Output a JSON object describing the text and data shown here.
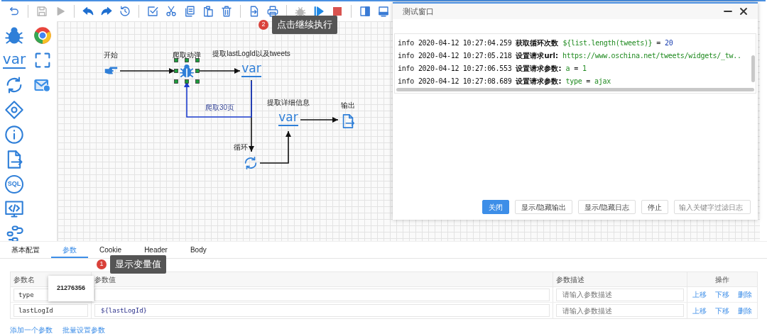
{
  "toolbar": [
    {
      "kind": "reset",
      "disabled": false
    },
    {
      "kind": "separator"
    },
    {
      "kind": "save",
      "disabled": true
    },
    {
      "kind": "play",
      "disabled": true
    },
    {
      "kind": "separator"
    },
    {
      "kind": "undo",
      "disabled": false
    },
    {
      "kind": "redo",
      "disabled": false
    },
    {
      "kind": "history",
      "disabled": false
    },
    {
      "kind": "separator"
    },
    {
      "kind": "select",
      "disabled": false
    },
    {
      "kind": "cut",
      "disabled": false
    },
    {
      "kind": "copy",
      "disabled": false
    },
    {
      "kind": "paste",
      "disabled": false
    },
    {
      "kind": "delete",
      "disabled": false
    },
    {
      "kind": "separator"
    },
    {
      "kind": "export",
      "disabled": false
    },
    {
      "kind": "print",
      "disabled": false
    },
    {
      "kind": "separator"
    },
    {
      "kind": "debug",
      "disabled": true
    },
    {
      "kind": "resume",
      "disabled": false
    },
    {
      "kind": "stop",
      "disabled": false
    },
    {
      "kind": "separator"
    },
    {
      "kind": "panel-side",
      "disabled": false
    },
    {
      "kind": "panel-bottom",
      "disabled": false
    }
  ],
  "toolbar_tooltip": {
    "badge": "2",
    "text": "点击继续执行"
  },
  "palette": [
    {
      "kind": "bug"
    },
    {
      "kind": "browser"
    },
    {
      "kind": "variable",
      "label": "var"
    },
    {
      "kind": "frame"
    },
    {
      "kind": "loop"
    },
    {
      "kind": "mail"
    },
    {
      "kind": "condition"
    },
    {
      "kind": "info"
    },
    {
      "kind": "output"
    },
    {
      "kind": "sql",
      "label": "SQL"
    },
    {
      "kind": "code"
    },
    {
      "kind": "function"
    }
  ],
  "canvas": {
    "nodes": [
      {
        "kind": "start",
        "label": "开始",
        "selected": false
      },
      {
        "kind": "spider",
        "label": "爬取动弹",
        "selected": true
      },
      {
        "kind": "variable",
        "label": "提取lastLogId以及tweets",
        "glyph": "var",
        "selected": false
      },
      {
        "kind": "loop",
        "label": "循环",
        "selected": false
      },
      {
        "kind": "variable",
        "label": "提取详细信息",
        "glyph": "var",
        "selected": false
      },
      {
        "kind": "output",
        "label": "输出",
        "selected": false
      }
    ],
    "edges": [
      {
        "highlighted": false
      },
      {
        "highlighted": false
      },
      {
        "highlighted": false
      },
      {
        "label": "爬取30页",
        "highlighted": true
      },
      {
        "highlighted": false
      },
      {
        "highlighted": false
      }
    ]
  },
  "test_window": {
    "title": "测试窗口",
    "logs": [
      {
        "level": "info",
        "time": "2020-04-12 10:27:04.259",
        "message": "获取循环次数",
        "tokens": [
          {
            "kind": "expr",
            "text": "${list.length(tweets)}"
          },
          {
            "kind": "op",
            "text": "="
          },
          {
            "kind": "number",
            "text": "20"
          }
        ]
      },
      {
        "level": "info",
        "time": "2020-04-12 10:27:05.218",
        "message": "设置请求url:",
        "tokens": [
          {
            "kind": "string",
            "text": "https://www.oschina.net/tweets/widgets/_tw.."
          }
        ]
      },
      {
        "level": "info",
        "time": "2020-04-12 10:27:06.553",
        "message": "设置请求参数:",
        "tokens": [
          {
            "kind": "string",
            "text": "a"
          },
          {
            "kind": "op",
            "text": "="
          },
          {
            "kind": "string",
            "text": "1"
          }
        ]
      },
      {
        "level": "info",
        "time": "2020-04-12 10:27:08.689",
        "message": "设置请求参数:",
        "tokens": [
          {
            "kind": "string",
            "text": "type"
          },
          {
            "kind": "op",
            "text": "="
          },
          {
            "kind": "string",
            "text": "ajax"
          }
        ]
      }
    ],
    "buttons": [
      {
        "label": "关闭",
        "primary": true
      },
      {
        "label": "显示/隐藏输出",
        "primary": false
      },
      {
        "label": "显示/隐藏日志",
        "primary": false
      },
      {
        "label": "停止",
        "primary": false
      }
    ],
    "filter": {
      "placeholder": "输入关键字过滤日志"
    }
  },
  "config": {
    "tabs": [
      {
        "label": "基本配置",
        "selected": false
      },
      {
        "label": "参数",
        "selected": true
      },
      {
        "label": "Cookie",
        "selected": false
      },
      {
        "label": "Header",
        "selected": false
      },
      {
        "label": "Body",
        "selected": false
      }
    ],
    "tooltip": {
      "badge": "1",
      "text": "显示变量值"
    },
    "table": {
      "columns": [
        "参数名",
        "参数值",
        "参数描述",
        "操作"
      ],
      "rows": [
        {
          "name": "type",
          "description": {
            "placeholder": "请输入参数描述"
          },
          "actions": [
            "上移",
            "下移",
            "删除"
          ]
        },
        {
          "name": "lastLogId",
          "value": "${lastLogId}",
          "description": {
            "placeholder": "请输入参数描述"
          },
          "actions": [
            "上移",
            "下移",
            "删除"
          ]
        }
      ]
    },
    "popover": "21276356",
    "links": [
      "添加一个参数",
      "批量设置参数"
    ]
  }
}
